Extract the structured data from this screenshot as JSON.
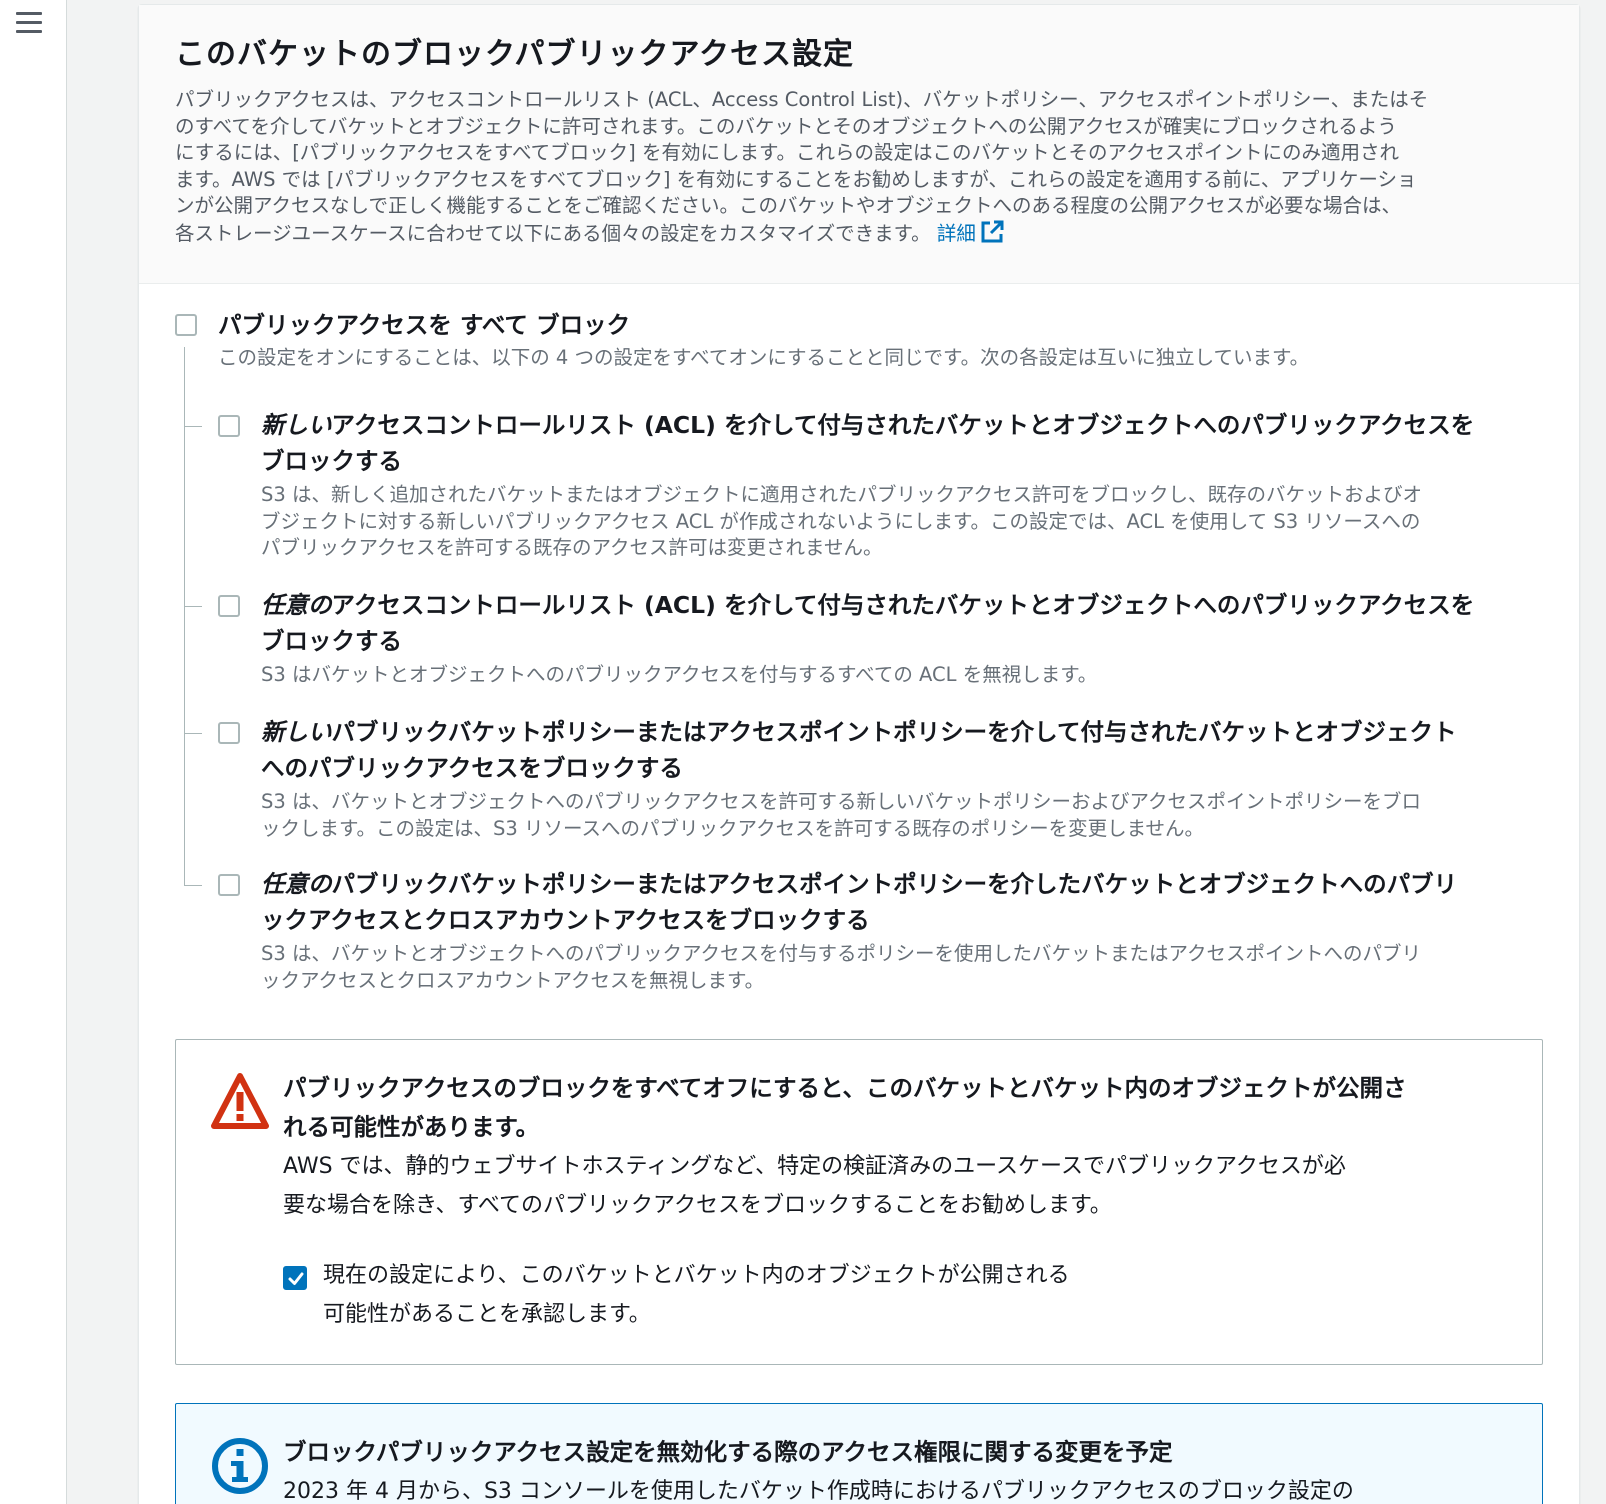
{
  "nav": {
    "menu_icon": "hamburger-menu-icon"
  },
  "panel": {
    "title": "このバケットのブロックパブリックアクセス設定",
    "description_lines": [
      "パブリックアクセスは、アクセスコントロールリスト (ACL、Access Control List)、バケットポリシー、アクセスポイントポリシー、またはそ",
      "のすべてを介してバケットとオブジェクトに許可されます。このバケットとそのオブジェクトへの公開アクセスが確実にブロックされるよう",
      "にするには、[パブリックアクセスをすべてブロック] を有効にします。これらの設定はこのバケットとそのアクセスポイントにのみ適用され",
      "ます。AWS では [パブリックアクセスをすべてブロック] を有効にすることをお勧めしますが、これらの設定を適用する前に、アプリケーショ",
      "ンが公開アクセスなしで正しく機能することをご確認ください。このバケットやオブジェクトへのある程度の公開アクセスが必要な場合は、",
      "各ストレージユースケースに合わせて以下にある個々の設定をカスタマイズできます。"
    ],
    "learn_more": "詳細"
  },
  "block_all": {
    "label": "パブリックアクセスを すべて ブロック",
    "description": "この設定をオンにすることは、以下の 4 つの設定をすべてオンにすることと同じです。次の各設定は互いに独立しています。",
    "checked": false
  },
  "options": [
    {
      "emph": "新しい",
      "label_line1": "アクセスコントロールリスト (ACL) を介して付与されたバケットとオブジェクトへのパブリックアクセスを",
      "label_line2": "ブロックする",
      "desc_lines": [
        "S3 は、新しく追加されたバケットまたはオブジェクトに適用されたパブリックアクセス許可をブロックし、既存のバケットおよびオ",
        "ブジェクトに対する新しいパブリックアクセス ACL が作成されないようにします。この設定では、ACL を使用して S3 リソースへの",
        "パブリックアクセスを許可する既存のアクセス許可は変更されません。"
      ],
      "checked": false
    },
    {
      "emph": "任意の",
      "label_line1": "アクセスコントロールリスト (ACL) を介して付与されたバケットとオブジェクトへのパブリックアクセスを",
      "label_line2": "ブロックする",
      "desc_lines": [
        "S3 はバケットとオブジェクトへのパブリックアクセスを付与するすべての ACL を無視します。"
      ],
      "checked": false
    },
    {
      "emph": "新しい",
      "label_line1": "パブリックバケットポリシーまたはアクセスポイントポリシーを介して付与されたバケットとオブジェクト",
      "label_line2": "へのパブリックアクセスをブロックする",
      "desc_lines": [
        "S3 は、バケットとオブジェクトへのパブリックアクセスを許可する新しいバケットポリシーおよびアクセスポイントポリシーをブロ",
        "ックします。この設定は、S3 リソースへのパブリックアクセスを許可する既存のポリシーを変更しません。"
      ],
      "checked": false
    },
    {
      "emph": "任意の",
      "label_line1": "パブリックバケットポリシーまたはアクセスポイントポリシーを介したバケットとオブジェクトへのパブリ",
      "label_line2": "ックアクセスとクロスアカウントアクセスをブロックする",
      "desc_lines": [
        "S3 は、バケットとオブジェクトへのパブリックアクセスを付与するポリシーを使用したバケットまたはアクセスポイントへのパブリ",
        "ックアクセスとクロスアカウントアクセスを無視します。"
      ],
      "checked": false
    }
  ],
  "warning": {
    "icon": "warning-triangle-icon",
    "color": "#d13212",
    "title_lines": [
      "パブリックアクセスのブロックをすべてオフにすると、このバケットとバケット内のオブジェクトが公開さ",
      "れる可能性があります。"
    ],
    "text_lines": [
      "AWS では、静的ウェブサイトホスティングなど、特定の検証済みのユースケースでパブリックアクセスが必",
      "要な場合を除き、すべてのパブリックアクセスをブロックすることをお勧めします。"
    ],
    "ack_lines": [
      "現在の設定により、このバケットとバケット内のオブジェクトが公開される",
      "可能性があることを承認します。"
    ],
    "ack_checked": true
  },
  "info": {
    "icon": "info-circle-icon",
    "color": "#0073bb",
    "title": "ブロックパブリックアクセス設定を無効化する際のアクセス権限に関する変更を予定",
    "text": "2023 年 4 月から、S3 コンソールを使用したバケット作成時におけるパブリックアクセスのブロック設定の"
  }
}
